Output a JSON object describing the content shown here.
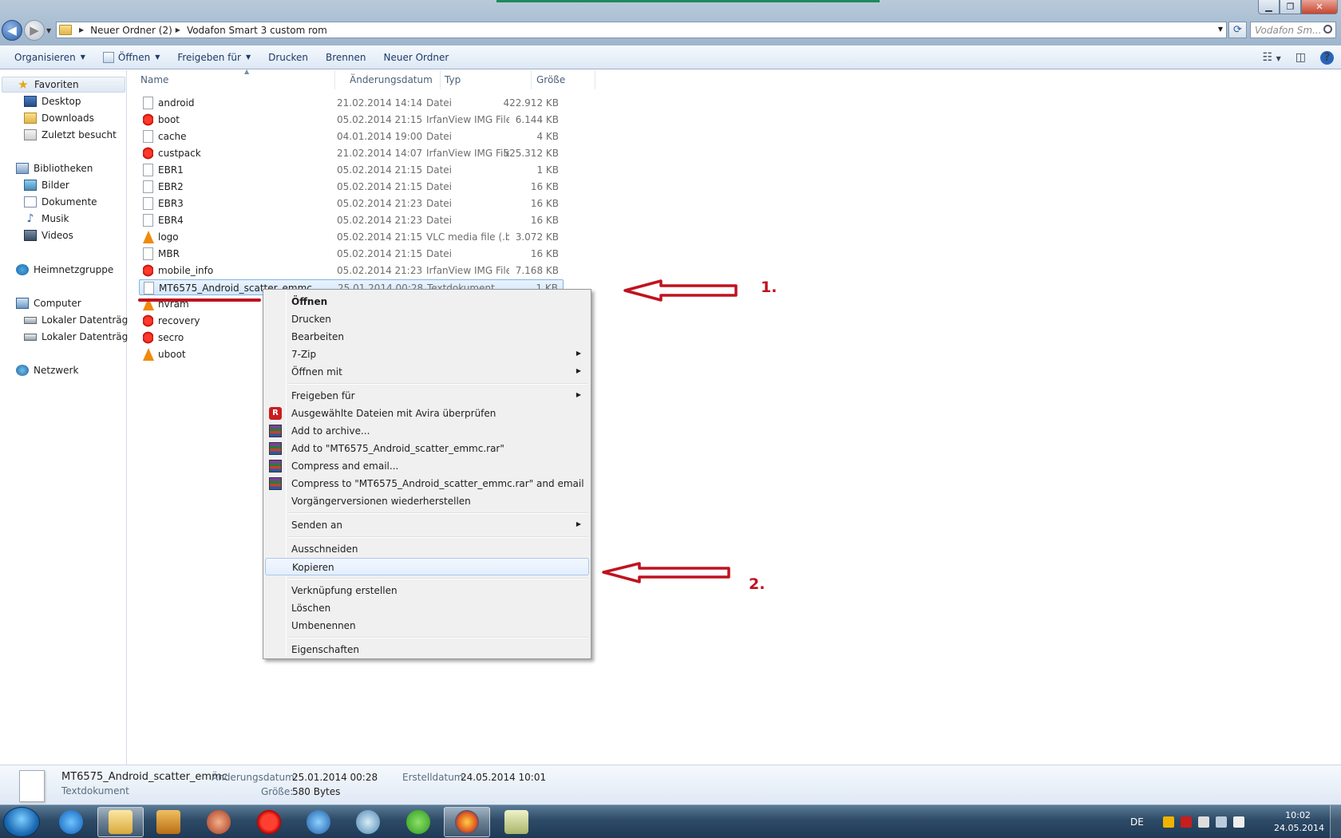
{
  "address": {
    "crumbs": [
      "Neuer Ordner (2)",
      "Vodafon Smart 3 custom rom"
    ],
    "search_placeholder": "Vodafon Sm..."
  },
  "commands": {
    "organize": "Organisieren",
    "open": "Öffnen",
    "share": "Freigeben für",
    "print": "Drucken",
    "burn": "Brennen",
    "new_folder": "Neuer Ordner"
  },
  "nav": {
    "favorites": "Favoriten",
    "desktop": "Desktop",
    "downloads": "Downloads",
    "recent": "Zuletzt besucht",
    "libraries": "Bibliotheken",
    "pictures": "Bilder",
    "documents": "Dokumente",
    "music": "Musik",
    "videos": "Videos",
    "homegroup": "Heimnetzgruppe",
    "computer": "Computer",
    "drive1": "Lokaler Datenträger",
    "drive2": "Lokaler Datenträger",
    "network": "Netzwerk"
  },
  "columns": {
    "name": "Name",
    "date": "Änderungsdatum",
    "type": "Typ",
    "size": "Größe"
  },
  "files": [
    {
      "name": "android",
      "date": "21.02.2014 14:14",
      "type": "Datei",
      "size": "422.912 KB",
      "icon": "doc-icon"
    },
    {
      "name": "boot",
      "date": "05.02.2014 21:15",
      "type": "IrfanView IMG File",
      "size": "6.144 KB",
      "icon": "irfanview-icon"
    },
    {
      "name": "cache",
      "date": "04.01.2014 19:00",
      "type": "Datei",
      "size": "4 KB",
      "icon": "doc-icon"
    },
    {
      "name": "custpack",
      "date": "21.02.2014 14:07",
      "type": "IrfanView IMG File",
      "size": "525.312 KB",
      "icon": "irfanview-icon"
    },
    {
      "name": "EBR1",
      "date": "05.02.2014 21:15",
      "type": "Datei",
      "size": "1 KB",
      "icon": "doc-icon"
    },
    {
      "name": "EBR2",
      "date": "05.02.2014 21:15",
      "type": "Datei",
      "size": "16 KB",
      "icon": "doc-icon"
    },
    {
      "name": "EBR3",
      "date": "05.02.2014 21:23",
      "type": "Datei",
      "size": "16 KB",
      "icon": "doc-icon"
    },
    {
      "name": "EBR4",
      "date": "05.02.2014 21:23",
      "type": "Datei",
      "size": "16 KB",
      "icon": "doc-icon"
    },
    {
      "name": "logo",
      "date": "05.02.2014 21:15",
      "type": "VLC media file (.bi...",
      "size": "3.072 KB",
      "icon": "vlc-icon"
    },
    {
      "name": "MBR",
      "date": "05.02.2014 21:15",
      "type": "Datei",
      "size": "16 KB",
      "icon": "doc-icon"
    },
    {
      "name": "mobile_info",
      "date": "05.02.2014 21:23",
      "type": "IrfanView IMG File",
      "size": "7.168 KB",
      "icon": "irfanview-icon"
    },
    {
      "name": "MT6575_Android_scatter_emmc",
      "date": "25.01.2014 00:28",
      "type": "Textdokument",
      "size": "1 KB",
      "icon": "doc-icon",
      "selected": true
    },
    {
      "name": "nvram",
      "date": "",
      "type": "",
      "size": "",
      "icon": "vlc-icon"
    },
    {
      "name": "recovery",
      "date": "",
      "type": "",
      "size": "",
      "icon": "irfanview-icon"
    },
    {
      "name": "secro",
      "date": "",
      "type": "",
      "size": "",
      "icon": "irfanview-icon"
    },
    {
      "name": "uboot",
      "date": "",
      "type": "",
      "size": "",
      "icon": "vlc-icon"
    }
  ],
  "context_menu": {
    "items": [
      {
        "label": "Öffnen",
        "bold": true
      },
      {
        "label": "Drucken"
      },
      {
        "label": "Bearbeiten"
      },
      {
        "label": "7-Zip",
        "submenu": true
      },
      {
        "label": "Öffnen mit",
        "submenu": true
      },
      {
        "separator": true
      },
      {
        "label": "Freigeben für",
        "submenu": true
      },
      {
        "label": "Ausgewählte Dateien mit Avira überprüfen",
        "icon": "avira-icon"
      },
      {
        "label": "Add to archive...",
        "icon": "winrar-icon"
      },
      {
        "label": "Add to \"MT6575_Android_scatter_emmc.rar\"",
        "icon": "winrar-icon"
      },
      {
        "label": "Compress and email...",
        "icon": "winrar-icon"
      },
      {
        "label": "Compress to \"MT6575_Android_scatter_emmc.rar\" and email",
        "icon": "winrar-icon"
      },
      {
        "label": "Vorgängerversionen wiederherstellen"
      },
      {
        "separator": true
      },
      {
        "label": "Senden an",
        "submenu": true
      },
      {
        "separator": true
      },
      {
        "label": "Ausschneiden"
      },
      {
        "label": "Kopieren",
        "highlighted": true
      },
      {
        "separator": true
      },
      {
        "label": "Verknüpfung erstellen"
      },
      {
        "label": "Löschen"
      },
      {
        "label": "Umbenennen"
      },
      {
        "separator": true
      },
      {
        "label": "Eigenschaften"
      }
    ]
  },
  "annotations": {
    "step1": "1.",
    "step2": "2.",
    "color": "#c0121f"
  },
  "details": {
    "filename": "MT6575_Android_scatter_emmc",
    "filetype": "Textdokument",
    "modified_label": "Änderungsdatum:",
    "modified_value": "25.01.2014 00:28",
    "created_label": "Erstelldatum:",
    "created_value": "24.05.2014 10:01",
    "size_label": "Größe:",
    "size_value": "580 Bytes"
  },
  "taskbar": {
    "apps": [
      "start-orb",
      "internet-explorer-icon",
      "explorer-icon",
      "media-player-icon",
      "browser-icon",
      "irfanview-icon",
      "thunderbird-icon",
      "network-tool-icon",
      "utorrent-icon",
      "firefox-icon",
      "folder-icon"
    ],
    "language": "DE",
    "time": "10:02",
    "date": "24.05.2014"
  }
}
